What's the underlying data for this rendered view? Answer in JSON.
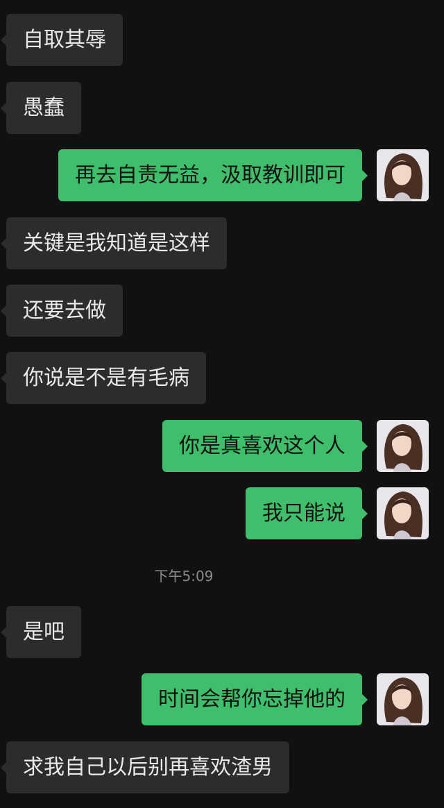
{
  "messages": [
    {
      "side": "received",
      "text": "自取其辱"
    },
    {
      "side": "received",
      "text": "愚蠢"
    },
    {
      "side": "sent",
      "text": "再去自责无益，汲取教训即可",
      "avatar": "woman-portrait-avatar"
    },
    {
      "side": "received",
      "text": "关键是我知道是这样"
    },
    {
      "side": "received",
      "text": "还要去做"
    },
    {
      "side": "received",
      "text": "你说是不是有毛病"
    },
    {
      "side": "sent",
      "text": "你是真喜欢这个人",
      "avatar": "woman-portrait-avatar"
    },
    {
      "side": "sent",
      "text": "我只能说",
      "avatar": "woman-portrait-avatar"
    },
    {
      "side": "received",
      "text": "是吧"
    },
    {
      "side": "sent",
      "text": "时间会帮你忘掉他的",
      "avatar": "woman-portrait-avatar"
    },
    {
      "side": "received",
      "text": "求我自己以后别再喜欢渣男"
    }
  ],
  "timestamp": "下午5:09",
  "colors": {
    "background": "#111111",
    "received_bubble": "#2c2c2c",
    "sent_bubble": "#3fbf6c",
    "timestamp_text": "#8a8a8a"
  }
}
